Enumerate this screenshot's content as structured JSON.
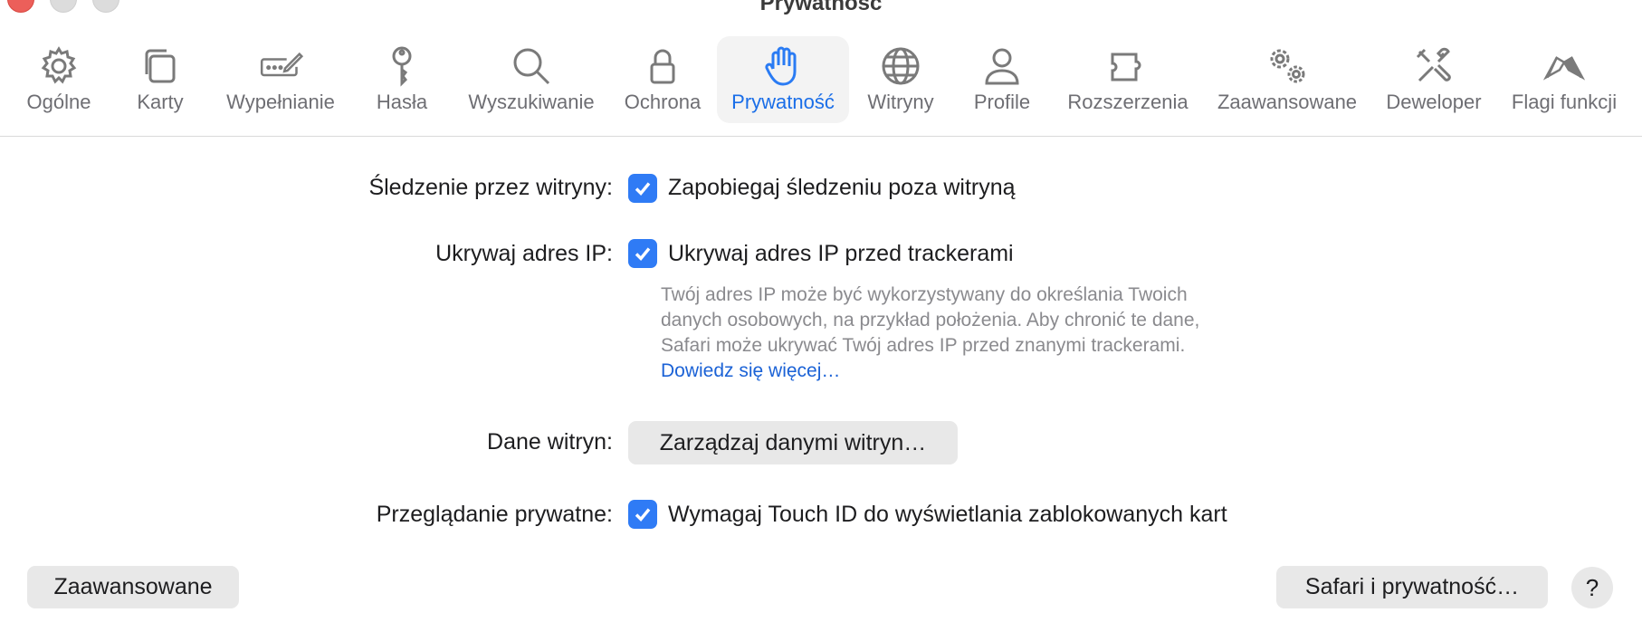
{
  "window": {
    "title": "Prywatność"
  },
  "toolbar": {
    "tabs": [
      {
        "label": "Ogólne",
        "icon": "gear-icon"
      },
      {
        "label": "Karty",
        "icon": "tabs-icon"
      },
      {
        "label": "Wypełnianie",
        "icon": "pen-field-icon"
      },
      {
        "label": "Hasła",
        "icon": "key-icon"
      },
      {
        "label": "Wyszukiwanie",
        "icon": "search-icon"
      },
      {
        "label": "Ochrona",
        "icon": "lock-icon"
      },
      {
        "label": "Prywatność",
        "icon": "hand-icon"
      },
      {
        "label": "Witryny",
        "icon": "globe-icon"
      },
      {
        "label": "Profile",
        "icon": "person-icon"
      },
      {
        "label": "Rozszerzenia",
        "icon": "puzzle-icon"
      },
      {
        "label": "Zaawansowane",
        "icon": "gears-icon"
      },
      {
        "label": "Deweloper",
        "icon": "tools-icon"
      },
      {
        "label": "Flagi funkcji",
        "icon": "flags-icon"
      }
    ],
    "active": "Prywatność"
  },
  "settings": {
    "tracking": {
      "label": "Śledzenie przez witryny:",
      "checkbox": "Zapobiegaj śledzeniu poza witryną",
      "checked": true
    },
    "hide_ip": {
      "label": "Ukrywaj adres IP:",
      "checkbox": "Ukrywaj adres IP przed trackerami",
      "checked": true,
      "desc_line1": "Twój adres IP może być wykorzystywany do określania Twoich",
      "desc_line2": "danych osobowych, na przykład położenia. Aby chronić te dane,",
      "desc_line3": "Safari może ukrywać Twój adres IP przed znanymi trackerami.",
      "link": "Dowiedz się więcej…"
    },
    "site_data": {
      "label": "Dane witryn:",
      "button": "Zarządzaj danymi witryn…"
    },
    "private": {
      "label": "Przeglądanie prywatne:",
      "checkbox": "Wymagaj Touch ID do wyświetlania zablokowanych kart",
      "checked": true
    }
  },
  "footer": {
    "advanced_button": "Zaawansowane",
    "privacy_button": "Safari i prywatność…",
    "help_button": "?"
  },
  "colors": {
    "accent": "#2f7bf5",
    "link": "#1b62d6",
    "close": "#ec5f5a"
  }
}
